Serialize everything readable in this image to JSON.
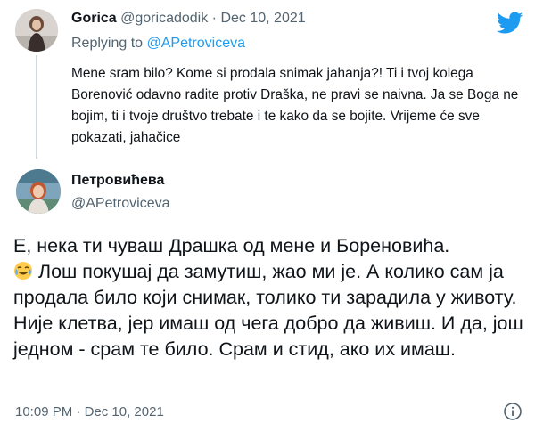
{
  "tweet1": {
    "author_name": "Gorica",
    "author_handle": "@goricadodik",
    "separator": "·",
    "date": "Dec 10, 2021",
    "replying_prefix": "Replying to",
    "replying_to": "@APetroviceva",
    "text": "Mene sram bilo? Kome si prodala snimak jahanja?! Ti i tvoj kolega Borenović odavno radite protiv Draška, ne pravi se naivna. Ja se Boga ne bojim, ti i tvoje društvo trebate i te kako da se bojite. Vrijeme će sve pokazati, jahačice"
  },
  "tweet2": {
    "author_name": "Петровићева",
    "author_handle": "@APetroviceva",
    "text_line1": "Е, нека ти чуваш Драшка од мене и Бореновића.",
    "emoji": "face-with-tears-of-joy",
    "text_rest": " Лош покушај да замутиш, жао ми је. А колико сам ја продала било који снимак, толико ти зарадила у животу. Није клетва, јер имаш од чега добро да живиш. И да, још једном - срам те било. Срам и стид, ако их имаш.",
    "time": "10:09 PM",
    "separator": "·",
    "date": "Dec 10, 2021"
  },
  "icons": {
    "brand": "twitter-bird-icon",
    "info": "info-icon"
  },
  "colors": {
    "brand_blue": "#1d9bf0",
    "secondary_text": "#536471",
    "primary_text": "#0f1419"
  }
}
